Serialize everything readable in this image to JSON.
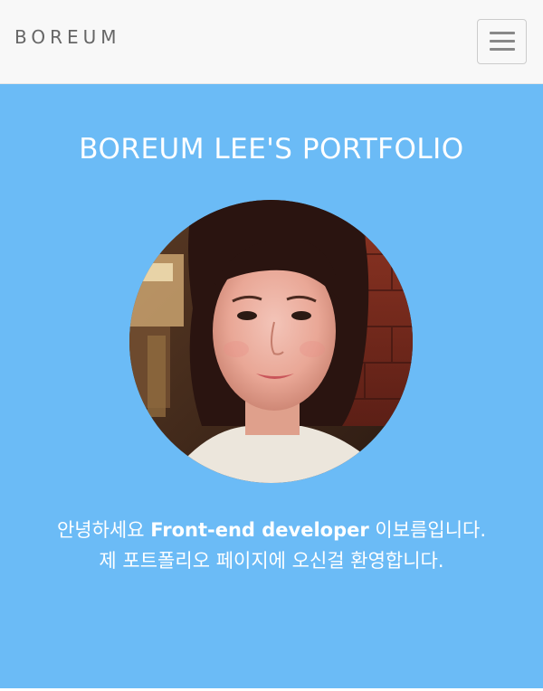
{
  "navbar": {
    "brand": "BOREUM",
    "toggle_icon": "hamburger-menu-icon"
  },
  "hero": {
    "title": "BOREUM LEE'S PORTFOLIO",
    "intro": {
      "line1_before": "안녕하세요 ",
      "line1_highlight": "Front-end developer",
      "line1_after": " 이보름입니다.",
      "line2": "제 포트폴리오 페이지에 오신걸 환영합니다."
    },
    "background_color": "#6bbbf6"
  }
}
